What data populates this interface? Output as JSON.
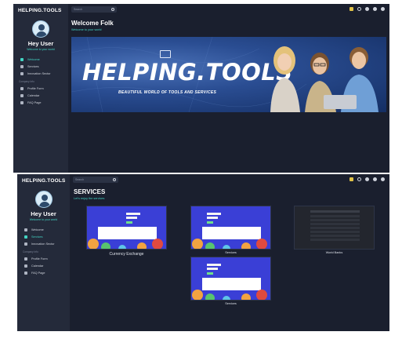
{
  "app": {
    "brand": "HELPING.TOOLS",
    "greeting": "Hey User",
    "greeting_sub": "Welcome to your world",
    "search_placeholder": "Search"
  },
  "sidebar": {
    "items_top": [
      {
        "label": "Welcome",
        "icon": "home-icon"
      },
      {
        "label": "Services",
        "icon": "briefcase-icon"
      },
      {
        "label": "Innovation Sector",
        "icon": "map-pin-icon"
      }
    ],
    "section_label": "Company Info",
    "items_bottom": [
      {
        "label": "Profile Form",
        "icon": "user-icon"
      },
      {
        "label": "Calendar",
        "icon": "calendar-icon"
      },
      {
        "label": "FAQ Page",
        "icon": "help-icon"
      }
    ]
  },
  "topbar_icons": [
    "translate-icon",
    "moon-icon",
    "bell-icon",
    "settings-icon",
    "user-icon"
  ],
  "screen1": {
    "title": "Welcome Folk",
    "subtitle": "Welcome to your world",
    "hero_title": "HELPING.TOOLS",
    "hero_tagline": "BEAUTIFUL WORLD OF TOOLS AND SERVICES",
    "active_item": "Welcome"
  },
  "screen2": {
    "title": "SERVICES",
    "subtitle": "Let's enjoy the services",
    "active_item": "Services",
    "cards": [
      {
        "caption": "Currency Exchange"
      },
      {
        "caption": "Services"
      },
      {
        "caption": "World Banks"
      },
      {
        "caption": "Services"
      }
    ]
  },
  "colors": {
    "background": "#1a1f2e",
    "sidebar": "#242a3a",
    "accent": "#43d4c3",
    "hero_blue": "#2a4d92",
    "card_blue": "#3a3fd6"
  }
}
